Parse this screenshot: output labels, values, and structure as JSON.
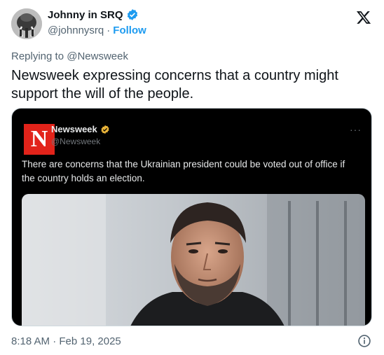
{
  "author": {
    "display_name": "Johnny in SRQ",
    "handle": "@johnnysrq",
    "separator": "·",
    "follow_label": "Follow",
    "avatar_icon": "mammoth-avatar-icon"
  },
  "replying": {
    "prefix": "Replying to",
    "mention": "@Newsweek"
  },
  "tweet": {
    "text": "Newsweek expressing concerns that a country might support the will of the people.",
    "timestamp": "8:18 AM · Feb 19, 2025"
  },
  "embedded": {
    "logo_letter": "N",
    "name": "Newsweek",
    "handle": "@Newsweek",
    "more": "···",
    "text": "There are concerns that the Ukrainian president could be voted out of office if the country holds an election."
  },
  "colors": {
    "accent": "#1d9bf0",
    "newsweek_red": "#e2231a",
    "gold_badge": "#e8b339"
  }
}
